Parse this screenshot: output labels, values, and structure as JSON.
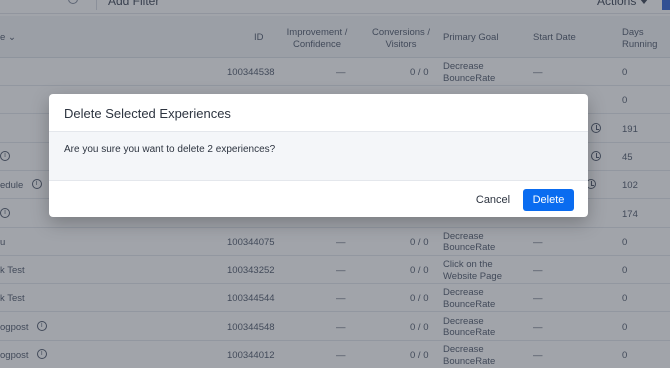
{
  "toolbar": {
    "add_filter_label": "Add Filter",
    "actions_label": "Actions"
  },
  "columns": {
    "name": "e",
    "id": "ID",
    "improvement": "Improvement /\nConfidence",
    "conversions": "Conversions /\nVisitors",
    "primary_goal": "Primary Goal",
    "start_date": "Start Date",
    "days_running": "Days\nRunning"
  },
  "rows": [
    {
      "name": "",
      "info": false,
      "id": "100344538",
      "improvement": "—",
      "conversions": "0 / 0",
      "goal": "Decrease\nBounceRate",
      "start": "—",
      "days": "0"
    },
    {
      "name": "",
      "info": false,
      "id": "",
      "improvement": "",
      "conversions": "",
      "goal": "Decrease",
      "start": "",
      "days": "0"
    },
    {
      "name": "",
      "info": false,
      "id": "",
      "improvement": "",
      "conversions": "",
      "goal": "",
      "start": "",
      "days": "191"
    },
    {
      "name": "",
      "info": true,
      "id": "",
      "improvement": "",
      "conversions": "",
      "goal": "",
      "start": "",
      "days": "45"
    },
    {
      "name": "edule",
      "info": true,
      "id": "",
      "improvement": "",
      "conversions": "",
      "goal": "",
      "start": "",
      "days": "102"
    },
    {
      "name": "",
      "info": true,
      "id": "",
      "improvement": "",
      "conversions": "",
      "goal": "BounceRate",
      "start": "",
      "days": "174"
    },
    {
      "name": "u",
      "info": false,
      "id": "100344075",
      "improvement": "—",
      "conversions": "0 / 0",
      "goal": "Decrease\nBounceRate",
      "start": "—",
      "days": "0"
    },
    {
      "name": "k Test",
      "info": false,
      "id": "100343252",
      "improvement": "—",
      "conversions": "0 / 0",
      "goal": "Click on the\nWebsite Page",
      "start": "—",
      "days": "0"
    },
    {
      "name": "k Test",
      "info": false,
      "id": "100344544",
      "improvement": "—",
      "conversions": "0 / 0",
      "goal": "Decrease\nBounceRate",
      "start": "—",
      "days": "0"
    },
    {
      "name": "ogpost",
      "info": true,
      "id": "100344548",
      "improvement": "—",
      "conversions": "0 / 0",
      "goal": "Decrease\nBounceRate",
      "start": "—",
      "days": "0"
    },
    {
      "name": "ogpost",
      "info": true,
      "id": "100344012",
      "improvement": "—",
      "conversions": "0 / 0",
      "goal": "Decrease\nBounceRate",
      "start": "—",
      "days": "0"
    }
  ],
  "dialog": {
    "title": "Delete Selected Experiences",
    "message": "Are you sure you want to delete 2 experiences?",
    "cancel_label": "Cancel",
    "delete_label": "Delete"
  },
  "colors": {
    "primary": "#0a6cf0",
    "overlay": "rgba(30,38,52,0.42)"
  }
}
